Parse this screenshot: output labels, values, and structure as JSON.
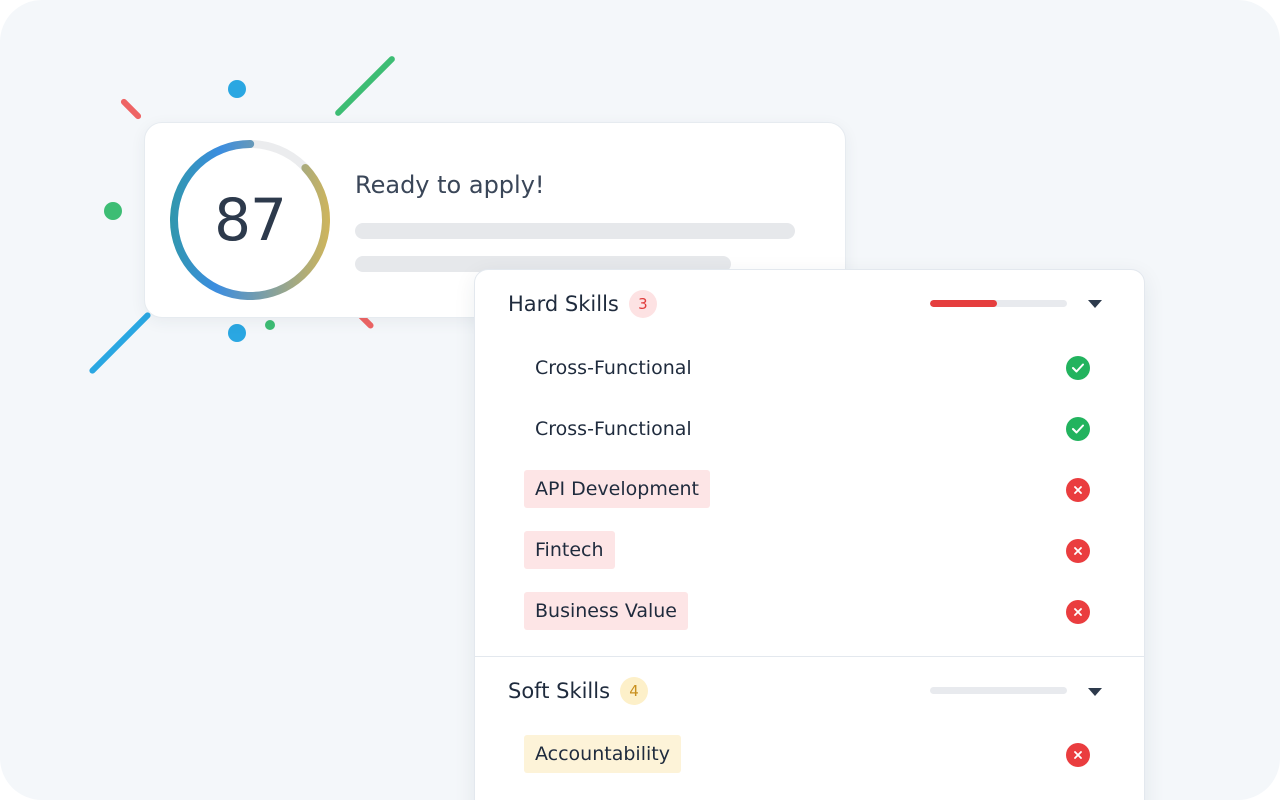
{
  "score": {
    "value": "87",
    "title": "Ready to apply!",
    "gauge_fraction": 0.87
  },
  "hard_skills": {
    "title": "Hard Skills",
    "count": "3",
    "progress_fraction": 0.49,
    "items": [
      {
        "label": "Cross-Functional",
        "status": "matched"
      },
      {
        "label": "Cross-Functional",
        "status": "matched"
      },
      {
        "label": "API Development",
        "status": "missing"
      },
      {
        "label": "Fintech",
        "status": "missing"
      },
      {
        "label": "Business Value",
        "status": "missing"
      }
    ]
  },
  "soft_skills": {
    "title": "Soft Skills",
    "count": "4",
    "progress_fraction": 0,
    "items": [
      {
        "label": "Accountability",
        "status": "missing"
      }
    ]
  },
  "icons": {
    "matched": "check-circle-icon",
    "missing": "x-circle-icon",
    "collapse": "chevron-down-icon"
  },
  "colors": {
    "accent_red": "#e53e3e",
    "success_green": "#22b35e",
    "warning_yellow": "#fdf3d8",
    "gauge_start": "#2a9d8f",
    "gauge_mid": "#f4bf3a",
    "gauge_end": "#3b8de0"
  }
}
